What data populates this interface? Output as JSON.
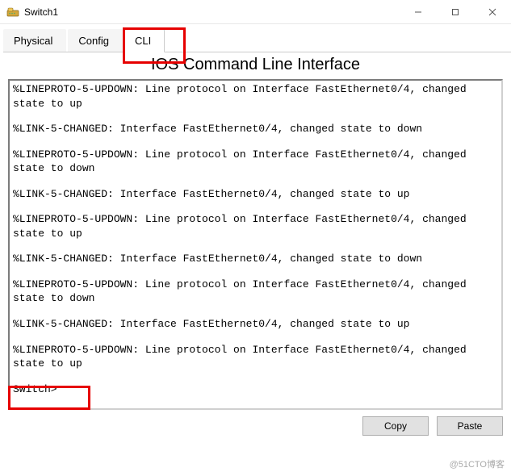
{
  "window": {
    "title": "Switch1"
  },
  "tabs": {
    "items": [
      {
        "label": "Physical"
      },
      {
        "label": "Config"
      },
      {
        "label": "CLI"
      }
    ],
    "active_index": 2
  },
  "cli": {
    "heading": "IOS Command Line Interface",
    "log": [
      "%LINEPROTO-5-UPDOWN: Line protocol on Interface FastEthernet0/4, changed state to up",
      "%LINK-5-CHANGED: Interface FastEthernet0/4, changed state to down",
      "%LINEPROTO-5-UPDOWN: Line protocol on Interface FastEthernet0/4, changed state to down",
      "%LINK-5-CHANGED: Interface FastEthernet0/4, changed state to up",
      "%LINEPROTO-5-UPDOWN: Line protocol on Interface FastEthernet0/4, changed state to up",
      "%LINK-5-CHANGED: Interface FastEthernet0/4, changed state to down",
      "%LINEPROTO-5-UPDOWN: Line protocol on Interface FastEthernet0/4, changed state to down",
      "%LINK-5-CHANGED: Interface FastEthernet0/4, changed state to up",
      "%LINEPROTO-5-UPDOWN: Line protocol on Interface FastEthernet0/4, changed state to up"
    ],
    "prompt": "Switch>"
  },
  "buttons": {
    "copy": "Copy",
    "paste": "Paste"
  },
  "watermark": "@51CTO博客"
}
